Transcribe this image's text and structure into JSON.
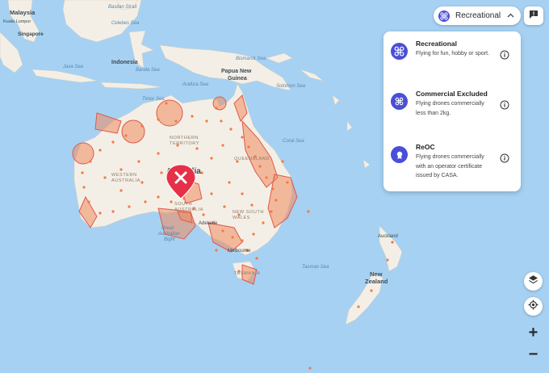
{
  "labels": {
    "malaysia": "Malaysia",
    "kuala_lumpur": "Kuala Lumpur",
    "singapore": "Singapore",
    "indonesia": "Indonesia",
    "java_sea": "Java Sea",
    "banda_sea": "Banda Sea",
    "celebes_sea": "Celebes Sea",
    "basilan": "Basilan Strait",
    "bismarck_sea": "Bismarck Sea",
    "papua_new_guinea": "Papua New\nGuinea",
    "solomon_sea": "Solomon Sea",
    "arafura_sea": "Arafura Sea",
    "timor_sea": "Timor Sea",
    "coral_sea": "Coral Sea",
    "northern_territory": "NORTHERN\nTERRITORY",
    "western_australia": "WESTERN\nAUSTRALIA",
    "queensland": "QUEENSLAND",
    "south_australia": "SOUTH\nAUSTRALIA",
    "new_south_wales": "NEW SOUTH\nWALES",
    "australia": "Australia",
    "adelaide": "Adelaide",
    "melbourne": "Melbourne",
    "tasmania": "TASMANIA",
    "great_australian_bight": "Great\nAustralian\nBight",
    "tasman_sea": "Tasman Sea",
    "auckland": "Auckland",
    "new_zealand": "New\nZealand"
  },
  "mode_select": {
    "selected": "Recreational",
    "icon": "drone-icon"
  },
  "mode_options": [
    {
      "title": "Recreational",
      "description": "Flying for fun, hobby or sport.",
      "icon": "drone-icon"
    },
    {
      "title": "Commercial Excluded",
      "description": "Flying drones commercially less than 2kg.",
      "icon": "drone-small-icon"
    },
    {
      "title": "ReOC",
      "description": "Flying drones commercially with an operator certificate issued by CASA.",
      "icon": "certificate-icon"
    }
  ],
  "controls": {
    "zoom_in": "+",
    "zoom_out": "−"
  },
  "colors": {
    "sea": "#a6d1f2",
    "land": "#f4efe6",
    "zone_fill": "#f08a5d",
    "zone_stroke": "#e0584a",
    "accent": "#4a4fd8",
    "marker": "#e53048"
  }
}
